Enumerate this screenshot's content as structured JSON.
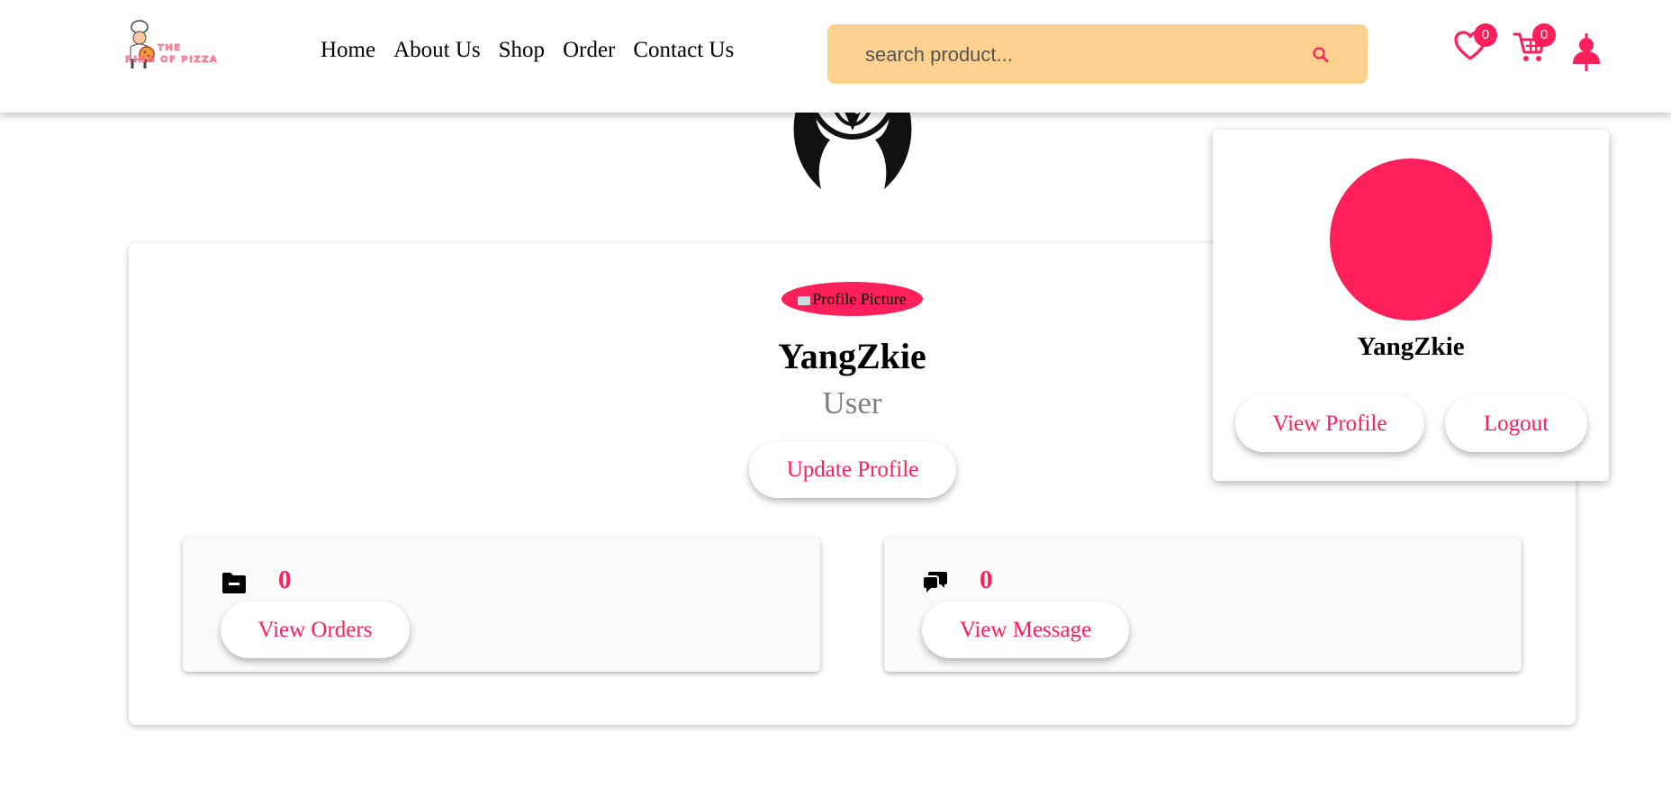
{
  "header": {
    "logo_text_line1": "THE",
    "logo_text_line2": "RING OF PIZZA",
    "nav": [
      "Home",
      "About Us",
      "Shop",
      "Order",
      "Contact Us"
    ],
    "search_placeholder": "search product...",
    "wishlist_count": "0",
    "cart_count": "0",
    "icons": [
      "heart-icon",
      "cart-icon",
      "user-icon",
      "search-icon"
    ]
  },
  "profile": {
    "picture_alt": "Profile Picture",
    "name": "YangZkie",
    "role": "User",
    "update_label": "Update Profile"
  },
  "stats": {
    "orders": {
      "count": "0",
      "label": "View Orders",
      "icon": "folder-minus-icon"
    },
    "messages": {
      "count": "0",
      "label": "View Message",
      "icon": "comments-icon"
    }
  },
  "dropdown": {
    "name": "YangZkie",
    "view_profile_label": "View Profile",
    "logout_label": "Logout"
  },
  "colors": {
    "accent": "#ff1f5a",
    "search_bg": "#fed18f"
  }
}
